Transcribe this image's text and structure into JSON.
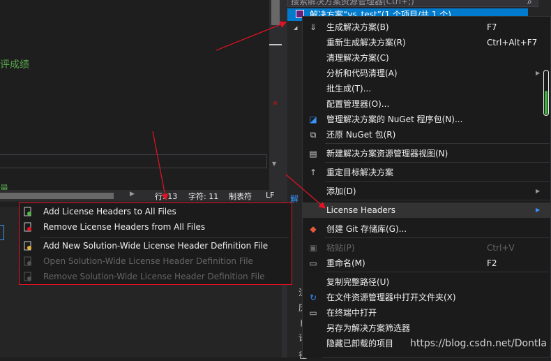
{
  "editor": {
    "green_text": "评成绩",
    "green_text2": "量"
  },
  "statusbar": {
    "line": "行: 13",
    "char": "字符: 11",
    "tab": "制表符",
    "eol": "LF"
  },
  "solution_explorer": {
    "search_placeholder": "搜索解决方案资源管理器(Ctrl+;)",
    "selected_item": "解决方案“vs_test”(1 个项目/共 1 个)",
    "side_label": "解",
    "side_chars": [
      "注",
      "历",
      "ド",
      "译",
      "径"
    ]
  },
  "context_menu": {
    "items": [
      {
        "label": "生成解决方案(B)",
        "shortcut": "F7",
        "icon": "build-icon",
        "glyph": "⇓"
      },
      {
        "label": "重新生成解决方案(R)",
        "shortcut": "Ctrl+Alt+F7"
      },
      {
        "label": "清理解决方案(C)",
        "shortcut": ""
      },
      {
        "label": "分析和代码清理(A)",
        "shortcut": "",
        "submenu": true
      },
      {
        "label": "批生成(T)...",
        "shortcut": ""
      },
      {
        "label": "配置管理器(O)...",
        "shortcut": ""
      },
      {
        "label": "管理解决方案的 NuGet 程序包(N)...",
        "shortcut": "",
        "icon": "nuget-icon",
        "glyph": "◪"
      },
      {
        "label": "还原 NuGet 包(R)",
        "shortcut": "",
        "icon": "restore-icon",
        "glyph": "⧉"
      },
      {
        "label": "新建解决方案资源管理器视图(N)",
        "shortcut": "",
        "icon": "new-view-icon",
        "glyph": "▤"
      },
      {
        "label": "重定目标解决方案",
        "shortcut": "",
        "icon": "retarget-icon",
        "glyph": "↑"
      },
      {
        "label": "添加(D)",
        "shortcut": "",
        "submenu": true
      },
      {
        "label": "License Headers",
        "shortcut": "",
        "submenu": true
      },
      {
        "label": "创建 Git 存储库(G)...",
        "shortcut": "",
        "icon": "git-icon",
        "glyph": "◆"
      },
      {
        "label": "粘贴(P)",
        "shortcut": "Ctrl+V",
        "icon": "paste-icon",
        "glyph": "▣",
        "disabled": true
      },
      {
        "label": "重命名(M)",
        "shortcut": "F2",
        "icon": "rename-icon",
        "glyph": "▭"
      },
      {
        "label": "复制完整路径(U)",
        "shortcut": ""
      },
      {
        "label": "在文件资源管理器中打开文件夹(X)",
        "shortcut": "",
        "icon": "open-folder-icon",
        "glyph": "↻"
      },
      {
        "label": "在终端中打开",
        "shortcut": "",
        "icon": "terminal-icon",
        "glyph": "▭"
      },
      {
        "label": "另存为解决方案筛选器",
        "shortcut": ""
      },
      {
        "label": "隐藏已卸载的项目",
        "shortcut": ""
      }
    ]
  },
  "submenu": {
    "items": [
      {
        "label": "Add License Headers to All Files",
        "disabled": false
      },
      {
        "label": "Remove License Headers from All Files",
        "disabled": false
      },
      {
        "label": "Add New Solution-Wide License Header Definition File",
        "disabled": false
      },
      {
        "label": "Open Solution-Wide License Header Definition File",
        "disabled": true
      },
      {
        "label": "Remove Solution-Wide License Header Definition File",
        "disabled": true
      }
    ]
  },
  "watermark": "https://blog.csdn.net/Dontla",
  "colors": {
    "accent": "#007acc",
    "highlight_red": "#e81123",
    "menu_bg": "#1b1b1c",
    "text": "#f1f1f1",
    "disabled": "#656565"
  }
}
